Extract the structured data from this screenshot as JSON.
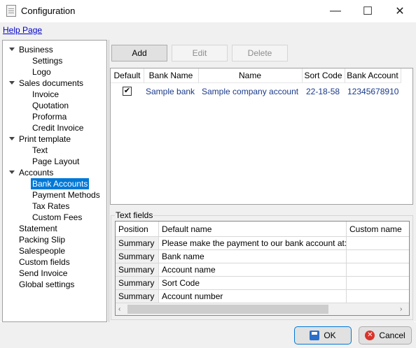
{
  "window": {
    "title": "Configuration",
    "minimize": "—",
    "maximize": "☐",
    "close": "✕"
  },
  "menu": {
    "help_link": "Help Page"
  },
  "tree": {
    "groups": [
      {
        "label": "Business",
        "children": [
          "Settings",
          "Logo"
        ]
      },
      {
        "label": "Sales documents",
        "children": [
          "Invoice",
          "Quotation",
          "Proforma",
          "Credit Invoice"
        ]
      },
      {
        "label": "Print template",
        "children": [
          "Text",
          "Page Layout"
        ]
      },
      {
        "label": "Accounts",
        "children": [
          "Bank Accounts",
          "Payment Methods",
          "Tax Rates",
          "Custom Fees"
        ]
      }
    ],
    "items": [
      "Statement",
      "Packing Slip",
      "Salespeople",
      "Custom fields",
      "Send Invoice",
      "Global settings"
    ],
    "selected": "Bank Accounts"
  },
  "toolbar": {
    "add": "Add",
    "edit": "Edit",
    "delete": "Delete"
  },
  "accounts_grid": {
    "columns": [
      "Default",
      "Bank Name",
      "Name",
      "Sort Code",
      "Bank Account"
    ],
    "rows": [
      {
        "default": true,
        "bank_name": "Sample bank",
        "name": "Sample company account",
        "sort_code": "22-18-58",
        "bank_account": "12345678910"
      }
    ]
  },
  "text_fields": {
    "label": "Text fields",
    "columns": [
      "Position",
      "Default name",
      "Custom name"
    ],
    "rows": [
      {
        "position": "Summary",
        "default_name": "Please make the payment to our bank account at:",
        "custom_name": ""
      },
      {
        "position": "Summary",
        "default_name": "Bank name",
        "custom_name": ""
      },
      {
        "position": "Summary",
        "default_name": "Account name",
        "custom_name": ""
      },
      {
        "position": "Summary",
        "default_name": "Sort Code",
        "custom_name": ""
      },
      {
        "position": "Summary",
        "default_name": "Account number",
        "custom_name": ""
      }
    ]
  },
  "footer": {
    "ok": "OK",
    "cancel": "Cancel"
  },
  "colors": {
    "selection": "#0078d7",
    "grid_text": "#1a3a8a",
    "link": "#0000cc"
  }
}
